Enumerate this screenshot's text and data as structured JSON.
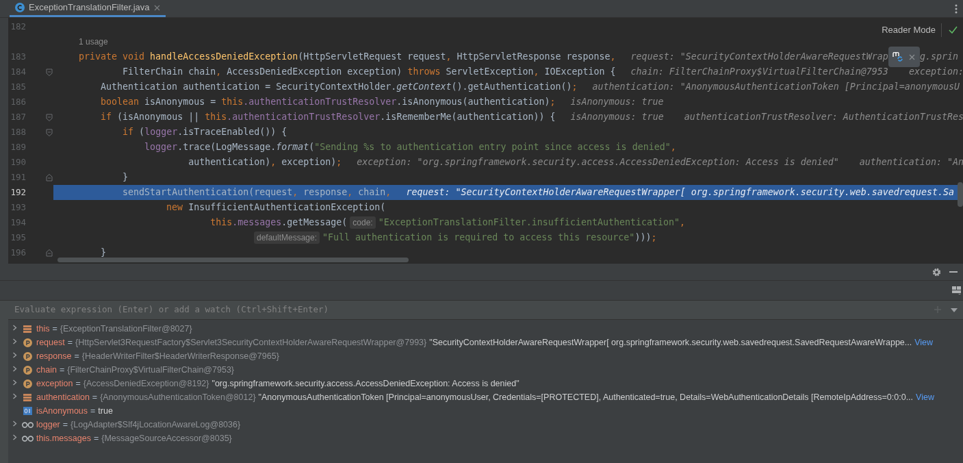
{
  "tab": {
    "title": "ExceptionTranslationFilter.java",
    "selected": true
  },
  "editor": {
    "reader_mode": "Reader Mode",
    "lines": [
      {
        "number": "182",
        "selected": false,
        "kind": "plain"
      },
      {
        "number": "183",
        "selected": false,
        "kind": "plain",
        "usages": "1 usage",
        "tokens": [
          {
            "kind": "kw",
            "text": "    private void "
          },
          {
            "kind": "fn",
            "text": "handleAccessDeniedException"
          },
          {
            "kind": "p",
            "text": "(HttpServletRequest request"
          },
          {
            "kind": "kw",
            "text": ", "
          },
          {
            "kind": "p",
            "text": "HttpServletResponse response"
          },
          {
            "kind": "kw",
            "text": ","
          }
        ],
        "hints": [
          {
            "kind": "text",
            "text": "request: \"SecurityContextHolderAwareRequestWrap"
          },
          {
            "kind": "popup"
          },
          {
            "kind": "text",
            "text": "g.sprin"
          }
        ]
      },
      {
        "number": "184",
        "selected": false,
        "kind": "fold-start",
        "tokens": [
          {
            "kind": "p",
            "text": "            FilterChain chain"
          },
          {
            "kind": "kw",
            "text": ", "
          },
          {
            "kind": "p",
            "text": "AccessDeniedException exception) "
          },
          {
            "kind": "kw",
            "text": "throws "
          },
          {
            "kind": "p",
            "text": "ServletException"
          },
          {
            "kind": "kw",
            "text": ", "
          },
          {
            "kind": "p",
            "text": "IOException {"
          }
        ],
        "hints": [
          {
            "kind": "text",
            "text": "chain: FilterChainProxy$VirtualFilterChain@7953"
          },
          {
            "kind": "text",
            "text": "exception:"
          }
        ]
      },
      {
        "number": "185",
        "selected": false,
        "kind": "plain",
        "tokens": [
          {
            "kind": "p",
            "text": "        Authentication authentication = SecurityContextHolder."
          },
          {
            "kind": "it",
            "text": "getContext"
          },
          {
            "kind": "p",
            "text": "().getAuthentication()"
          },
          {
            "kind": "kw",
            "text": ";"
          }
        ],
        "hints": [
          {
            "kind": "text",
            "text": "authentication: \"AnonymousAuthenticationToken [Principal=anonymousU"
          }
        ]
      },
      {
        "number": "186",
        "selected": false,
        "kind": "plain",
        "tokens": [
          {
            "kind": "kw",
            "text": "        boolean "
          },
          {
            "kind": "p",
            "text": "isAnonymous = "
          },
          {
            "kind": "kw",
            "text": "this"
          },
          {
            "kind": "field",
            "text": ".authenticationTrustResolver"
          },
          {
            "kind": "p",
            "text": ".isAnonymous(authentication)"
          },
          {
            "kind": "kw",
            "text": ";"
          }
        ],
        "hints": [
          {
            "kind": "text",
            "text": "isAnonymous: true"
          }
        ]
      },
      {
        "number": "187",
        "selected": false,
        "kind": "fold-start",
        "tokens": [
          {
            "kind": "kw",
            "text": "        if "
          },
          {
            "kind": "p",
            "text": "(isAnonymous || "
          },
          {
            "kind": "kw",
            "text": "this"
          },
          {
            "kind": "field",
            "text": ".authenticationTrustResolver"
          },
          {
            "kind": "p",
            "text": ".isRememberMe(authentication)) {"
          }
        ],
        "hints": [
          {
            "kind": "text",
            "text": "isAnonymous: true"
          },
          {
            "kind": "text",
            "text": "authenticationTrustResolver: AuthenticationTrustRes"
          }
        ]
      },
      {
        "number": "188",
        "selected": false,
        "kind": "fold-start",
        "tokens": [
          {
            "kind": "kw",
            "text": "            if "
          },
          {
            "kind": "p",
            "text": "("
          },
          {
            "kind": "field",
            "text": "logger"
          },
          {
            "kind": "p",
            "text": ".isTraceEnabled()) {"
          }
        ]
      },
      {
        "number": "189",
        "selected": false,
        "kind": "plain",
        "tokens": [
          {
            "kind": "field",
            "text": "                logger"
          },
          {
            "kind": "p",
            "text": ".trace(LogMessage."
          },
          {
            "kind": "it",
            "text": "format"
          },
          {
            "kind": "p",
            "text": "("
          },
          {
            "kind": "str",
            "text": "\"Sending %s to authentication entry point since access is denied\""
          },
          {
            "kind": "kw",
            "text": ","
          }
        ]
      },
      {
        "number": "190",
        "selected": false,
        "kind": "plain",
        "tokens": [
          {
            "kind": "p",
            "text": "                        authentication)"
          },
          {
            "kind": "kw",
            "text": ", "
          },
          {
            "kind": "p",
            "text": "exception)"
          },
          {
            "kind": "kw",
            "text": ";"
          }
        ],
        "hints": [
          {
            "kind": "text",
            "text": "exception: \"org.springframework.security.access.AccessDeniedException: Access is denied\""
          },
          {
            "kind": "text",
            "text": "authentication: \"An"
          }
        ]
      },
      {
        "number": "191",
        "selected": false,
        "kind": "fold-end",
        "tokens": [
          {
            "kind": "p",
            "text": "            }"
          }
        ]
      },
      {
        "number": "192",
        "selected": true,
        "kind": "plain",
        "tokens": [
          {
            "kind": "p",
            "text": "            sendStartAuthentication(request"
          },
          {
            "kind": "kw",
            "text": ", "
          },
          {
            "kind": "p",
            "text": "response"
          },
          {
            "kind": "kw",
            "text": ", "
          },
          {
            "kind": "p",
            "text": "chain"
          },
          {
            "kind": "kw",
            "text": ","
          }
        ],
        "hints": [
          {
            "kind": "text",
            "text": "request: \"SecurityContextHolderAwareRequestWrapper[ org.springframework.security.web.savedrequest.Sa"
          }
        ]
      },
      {
        "number": "193",
        "selected": false,
        "kind": "plain",
        "tokens": [
          {
            "kind": "kw",
            "text": "                    new "
          },
          {
            "kind": "p",
            "text": "InsufficientAuthenticationException("
          }
        ]
      },
      {
        "number": "194",
        "selected": false,
        "kind": "plain",
        "tokens": [
          {
            "kind": "kw",
            "text": "                            this"
          },
          {
            "kind": "field",
            "text": ".messages"
          },
          {
            "kind": "p",
            "text": ".getMessage("
          },
          {
            "kind": "param",
            "text": "code:"
          },
          {
            "kind": "str",
            "text": "\"ExceptionTranslationFilter.insufficientAuthentication\""
          },
          {
            "kind": "kw",
            "text": ","
          }
        ]
      },
      {
        "number": "195",
        "selected": false,
        "kind": "plain",
        "tokens": [
          {
            "kind": "param",
            "text": "defaultMessage:"
          },
          {
            "kind": "str",
            "text": "\"Full authentication is required to access this resource\""
          },
          {
            "kind": "p",
            "text": ")))"
          },
          {
            "kind": "kw",
            "text": ";"
          }
        ]
      },
      {
        "number": "196",
        "selected": false,
        "kind": "fold-end",
        "tokens": [
          {
            "kind": "p",
            "text": "        }"
          }
        ]
      }
    ]
  },
  "debugger": {
    "evaluate": {
      "placeholder": "Evaluate expression (Enter) or add a watch (Ctrl+Shift+Enter)"
    },
    "variables": [
      {
        "kind": "field",
        "expandable": true,
        "name": "this",
        "operator": "=",
        "value": "{ExceptionTranslationFilter@8027}"
      },
      {
        "kind": "param",
        "expandable": true,
        "name": "request",
        "operator": "=",
        "value": "{HttpServlet3RequestFactory$Servlet3SecurityContextHolderAwareRequestWrapper@7993}",
        "string": "\"SecurityContextHolderAwareRequestWrapper[ org.springframework.security.web.savedrequest.SavedRequestAwareWrappe...",
        "link": "View"
      },
      {
        "kind": "param",
        "expandable": true,
        "name": "response",
        "operator": "=",
        "value": "{HeaderWriterFilter$HeaderWriterResponse@7965}"
      },
      {
        "kind": "param",
        "expandable": true,
        "name": "chain",
        "operator": "=",
        "value": "{FilterChainProxy$VirtualFilterChain@7953}"
      },
      {
        "kind": "param",
        "expandable": true,
        "name": "exception",
        "operator": "=",
        "value": "{AccessDeniedException@8192}",
        "string": "\"org.springframework.security.access.AccessDeniedException: Access is denied\""
      },
      {
        "kind": "field",
        "expandable": true,
        "name": "authentication",
        "operator": "=",
        "value": "{AnonymousAuthenticationToken@8012}",
        "string": "\"AnonymousAuthenticationToken [Principal=anonymousUser, Credentials=[PROTECTED], Authenticated=true, Details=WebAuthenticationDetails [RemoteIpAddress=0:0:0...",
        "link": "View"
      },
      {
        "kind": "boolean",
        "expandable": false,
        "name": "isAnonymous",
        "operator": "=",
        "value": "true"
      },
      {
        "kind": "watch",
        "expandable": true,
        "name": "logger",
        "operator": "=",
        "value": "{LogAdapter$Slf4jLocationAwareLog@8036}"
      },
      {
        "kind": "watch",
        "expandable": true,
        "name": "this.messages",
        "operator": "=",
        "value": "{MessageSourceAccessor@8035}"
      }
    ]
  }
}
